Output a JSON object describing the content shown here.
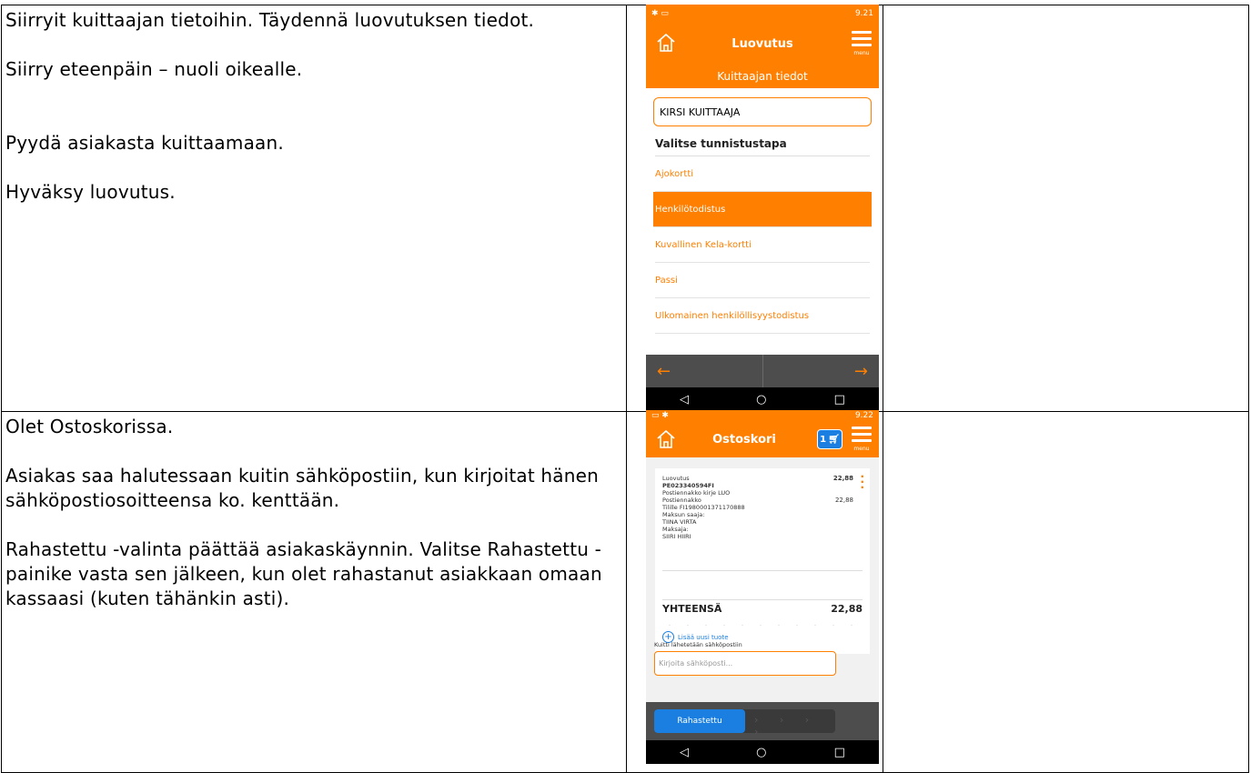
{
  "row1": {
    "instructions": [
      "Siirryit kuittaajan tietoihin. Täydennä luovutuksen tiedot.",
      "Siirry eteenpäin – nuoli oikealle.",
      "Pyydä asiakasta kuittaamaan.",
      "Hyväksy luovutus."
    ],
    "phone": {
      "status_time": "9.21",
      "title": "Luovutus",
      "menu_label": "menu",
      "subtitle": "Kuittaajan tiedot",
      "name_value": "KIRSI KUITTAAJA",
      "section_title": "Valitse tunnistustapa",
      "options": [
        "Ajokortti",
        "Henkilötodistus",
        "Kuvallinen Kela-kortti",
        "Passi",
        "Ulkomainen henkilöllisyystodistus"
      ],
      "selected_option": "Henkilötodistus",
      "back_arrow": "←",
      "forward_arrow": "→"
    }
  },
  "row2": {
    "instructions": [
      "Olet Ostoskorissa.",
      "Asiakas saa halutessaan kuitin sähköpostiin, kun kirjoitat hänen sähköpostiosoitteensa ko. kenttään.",
      "Rahastettu -valinta päättää asiakaskäynnin. Valitse Rahastettu -painike vasta sen jälkeen, kun olet rahastanut asiakkaan omaan kassaasi (kuten tähänkin asti)."
    ],
    "phone": {
      "status_time": "9.22",
      "title": "Ostoskori",
      "menu_label": "menu",
      "cart_count": "1",
      "receipt_lines": [
        "Luovutus",
        "PE023340594FI",
        "Postiennakko kirje LUO",
        "Postiennakko",
        "Tilille FI1980001371170888",
        "Maksun saaja:",
        "TIINA VIRTA",
        "Maksaja:",
        "SIIRI HIIRI"
      ],
      "item_amount": "22,88",
      "line_amount": "22,88",
      "total_label": "YHTEENSÄ",
      "total_value": "22,88",
      "add_item": "Lisää uusi tuote",
      "email_label": "Kuitti lähetetään sähköpostiin",
      "email_placeholder": "Kirjoita sähköposti...",
      "pay_button": "Rahastettu",
      "pay_chevrons": "› › › ›"
    }
  },
  "colors": {
    "brand_orange": "#ff7f00",
    "accent_blue": "#1a7fe0",
    "dark_bar": "#4d4d4d"
  },
  "icons": {
    "home": "home-icon",
    "menu": "hamburger-menu-icon",
    "cart": "cart-icon",
    "back": "arrow-left-icon",
    "forward": "arrow-right-icon",
    "add": "plus-circle-icon",
    "more": "kebab-menu-icon"
  }
}
